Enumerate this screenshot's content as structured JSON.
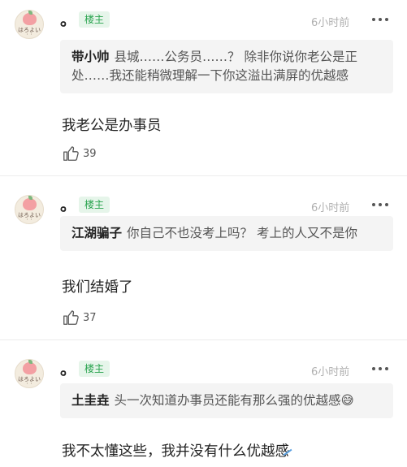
{
  "comments": [
    {
      "username": "。",
      "badge": "楼主",
      "timestamp": "6小时前",
      "avatar_caption": "はろよい",
      "avatar_sub": "・・",
      "quote": {
        "name": "带小帅",
        "text": "县城……公务员……？ 除非你说你老公是正处……我还能稍微理解一下你这溢出满屏的优越感"
      },
      "reply": "我老公是办事员",
      "likes": "39"
    },
    {
      "username": "。",
      "badge": "楼主",
      "timestamp": "6小时前",
      "avatar_caption": "はろよい",
      "avatar_sub": "・・",
      "quote": {
        "name": "江湖骗子",
        "text": "你自己不也没考上吗？ 考上的人又不是你"
      },
      "reply": "我们结婚了",
      "likes": "37"
    },
    {
      "username": "。",
      "badge": "楼主",
      "timestamp": "6小时前",
      "avatar_caption": "はろよい",
      "avatar_sub": "・・",
      "quote": {
        "name": "土圭垚",
        "text": "头一次知道办事员还能有那么强的优越感😅"
      },
      "reply": "我不太懂这些，我并没有什么优越感",
      "likes": ""
    }
  ],
  "icons": {
    "more": "more-options-icon",
    "like": "thumbs-up-icon"
  },
  "colors": {
    "badge_text": "#2aa44f",
    "badge_bg": "#e6f5ea",
    "quote_bg": "#f4f4f4"
  }
}
